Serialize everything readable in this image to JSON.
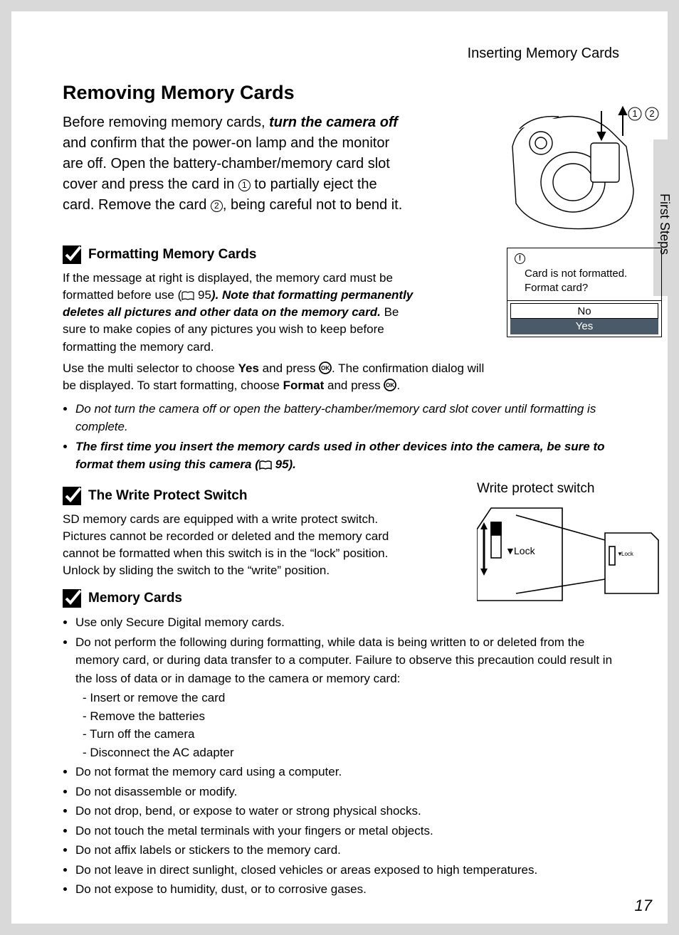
{
  "header": {
    "running_head": "Inserting Memory Cards"
  },
  "side_tab": "First Steps",
  "page_number": "17",
  "title": "Removing Memory Cards",
  "intro": {
    "p1a": "Before removing memory cards, ",
    "p1b": "turn the camera off",
    "p1c": " and confirm that the power-on lamp and the monitor are off. Open the battery-chamber/memory card slot cover and press the card in ",
    "step1": "1",
    "p1d": " to partially eject the card. Remove the card ",
    "step2": "2",
    "p1e": ", being careful not to bend it."
  },
  "illus": {
    "label1": "1",
    "label2": "2"
  },
  "lcd": {
    "line1": "Card is not formatted.",
    "line2": "Format card?",
    "no": "No",
    "yes": "Yes"
  },
  "sect1": {
    "title": "Formatting Memory Cards",
    "p1a": "If the message at right is displayed, the memory card must be formatted before use (",
    "p1ref": " 95",
    "p1b": "). ",
    "p1c": "Note that formatting permanently deletes all pictures and other data on the memory card.",
    "p1d": " Be sure to make copies of any pictures you wish to keep before formatting the memory card.",
    "p2a": "Use the multi selector to choose ",
    "p2b": "Yes",
    "p2c": " and press ",
    "p2d": ". The confirmation dialog will be displayed. To start formatting, choose ",
    "p2e": "Format",
    "p2f": " and press ",
    "p2g": ".",
    "b1": "Do not turn the camera off or open the battery-chamber/memory card slot cover until formatting is complete.",
    "b2a": "The first time you insert the memory cards used in other devices into the camera, be sure to format them using this camera (",
    "b2ref": " 95).",
    "b2c": ""
  },
  "sect2": {
    "title": "The Write Protect Switch",
    "p1": "SD memory cards are equipped with a write protect switch. Pictures cannot be recorded or deleted and the memory card cannot be formatted when this switch is in the “lock” position. Unlock by sliding the switch to the “write” position.",
    "fig_label": "Write protect switch",
    "lock_label": "Lock",
    "lock_label_sm": "Lock"
  },
  "sect3": {
    "title": "Memory Cards",
    "b1": "Use only Secure Digital memory cards.",
    "b2": "Do not perform the following during formatting, while data is being written to or deleted from the memory card, or during data transfer to a computer. Failure to observe this precaution could result in the loss of data or in damage to the camera or memory card:",
    "b2s1": "Insert or remove the card",
    "b2s2": "Remove the batteries",
    "b2s3": "Turn off the camera",
    "b2s4": "Disconnect the AC adapter",
    "b3": "Do not format the memory card using a computer.",
    "b4": "Do not disassemble or modify.",
    "b5": "Do not drop, bend, or expose to water or strong physical shocks.",
    "b6": "Do not touch the metal terminals with your fingers or metal objects.",
    "b7": "Do not affix labels or stickers to the memory card.",
    "b8": "Do not leave in direct sunlight, closed vehicles or areas exposed to high temperatures.",
    "b9": "Do not expose to humidity, dust, or to corrosive gases."
  }
}
